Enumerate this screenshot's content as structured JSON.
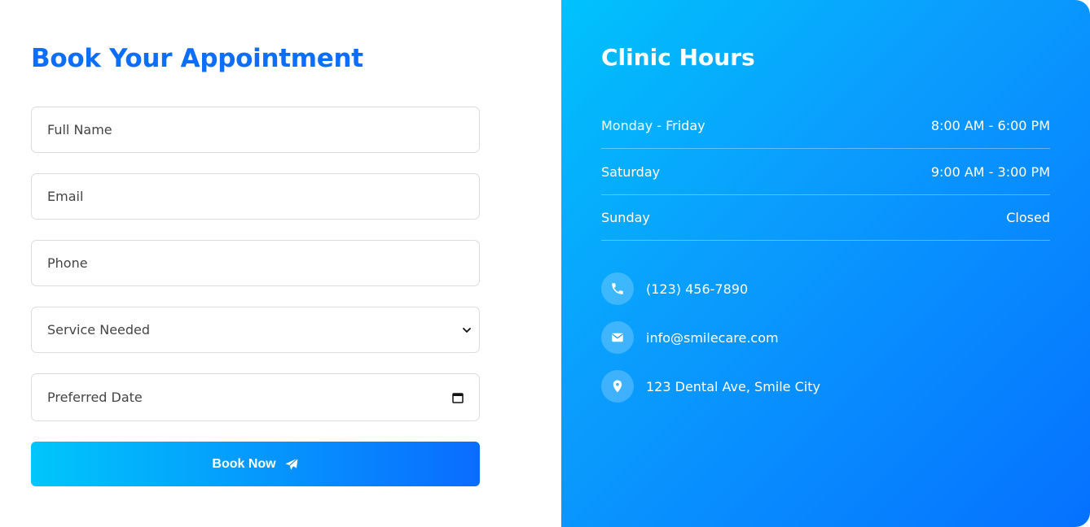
{
  "booking": {
    "title": "Book Your Appointment",
    "fields": {
      "full_name_placeholder": "Full Name",
      "email_placeholder": "Email",
      "phone_placeholder": "Phone",
      "service_selected": "Service Needed",
      "date_placeholder": "Preferred Date"
    },
    "submit_label": "Book Now",
    "submit_icon": "paper-plane-icon",
    "accent_color": "#0d6efd",
    "button_gradient": [
      "#00c6fb",
      "#0a6cff"
    ]
  },
  "clinic": {
    "title": "Clinic Hours",
    "hours": [
      {
        "day": "Monday - Friday",
        "time": "8:00 AM - 6:00 PM"
      },
      {
        "day": "Saturday",
        "time": "9:00 AM - 3:00 PM"
      },
      {
        "day": "Sunday",
        "time": "Closed"
      }
    ],
    "contacts": [
      {
        "icon": "phone-icon",
        "text": "(123) 456-7890"
      },
      {
        "icon": "envelope-icon",
        "text": "info@smilecare.com"
      },
      {
        "icon": "location-pin-icon",
        "text": "123 Dental Ave, Smile City"
      }
    ],
    "panel_gradient": [
      "#00c2fc",
      "#0571ff"
    ]
  }
}
